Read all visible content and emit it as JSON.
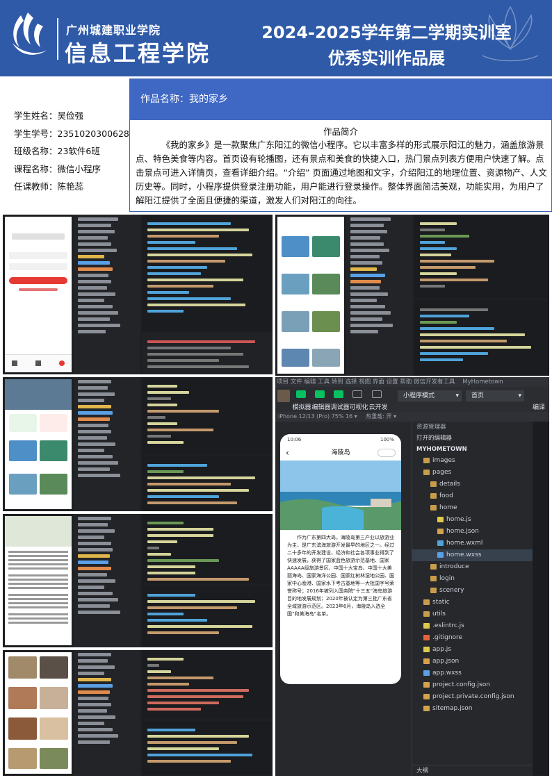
{
  "header": {
    "school": "广州城建职业学院",
    "college": "信息工程学院",
    "exhibit_title": "2024-2025学年第二学期实训室",
    "exhibit_subtitle": "优秀实训作品展"
  },
  "student_info": [
    "学生姓名：吴俭强",
    "学生学号：2351020300628",
    "班级名称：23软件6班",
    "课程名称：微信小程序",
    "任课教师：陈艳蕊"
  ],
  "work": {
    "name_line": "作品名称：我的家乡",
    "intro_title": "作品简介",
    "intro_body": "《我的家乡》是一款聚焦广东阳江的微信小程序。它以丰富多样的形式展示阳江的魅力，涵盖旅游景点、特色美食等内容。首页设有轮播图，还有景点和美食的快捷入口，热门景点列表方便用户快速了解。点击景点可进入详情页，查看详细介绍。“介绍” 页面通过地图和文字，介绍阳江的地理位置、资源物产、人文历史等。同时，小程序提供登录注册功能，用户能进行登录操作。整体界面简洁美观，功能实用，为用户了解阳江提供了全面且便捷的渠道，激发人们对阳江的向往。"
  },
  "ide": {
    "menu": "项目 文件 编辑 工具 转到 选择 视图 界面 设置 帮助 微信开发者工具",
    "project_name": "MyHometown",
    "toolbar": [
      "模拟器",
      "编辑器",
      "调试器",
      "可视化",
      "云开发"
    ],
    "compile_mode": "小程序模式",
    "page_select": "首页",
    "translate": "编译",
    "device": "iPhone 12/13 (Pro) 75% 16 ▾",
    "hot_reload": "热重载: 开 ▾",
    "explorer_title": "资源管理器",
    "open_editors": "打开的编辑器",
    "root_folder": "MYHOMETOWN",
    "outline": "大纲",
    "file_tree": [
      {
        "name": "images",
        "kind": "folder",
        "depth": 1
      },
      {
        "name": "pages",
        "kind": "folder",
        "depth": 1
      },
      {
        "name": "details",
        "kind": "folder",
        "depth": 2
      },
      {
        "name": "food",
        "kind": "folder",
        "depth": 2
      },
      {
        "name": "home",
        "kind": "folder",
        "depth": 2
      },
      {
        "name": "home.js",
        "kind": "js",
        "depth": 3
      },
      {
        "name": "home.json",
        "kind": "json",
        "depth": 3
      },
      {
        "name": "home.wxml",
        "kind": "wxml",
        "depth": 3
      },
      {
        "name": "home.wxss",
        "kind": "wxss",
        "depth": 3
      },
      {
        "name": "introduce",
        "kind": "folder",
        "depth": 2
      },
      {
        "name": "login",
        "kind": "folder",
        "depth": 2
      },
      {
        "name": "scenery",
        "kind": "folder",
        "depth": 2
      },
      {
        "name": "static",
        "kind": "folder",
        "depth": 1
      },
      {
        "name": "utils",
        "kind": "folder",
        "depth": 1
      },
      {
        "name": ".eslintrc.js",
        "kind": "js",
        "depth": 1
      },
      {
        "name": ".gitignore",
        "kind": "git",
        "depth": 1
      },
      {
        "name": "app.js",
        "kind": "js",
        "depth": 1
      },
      {
        "name": "app.json",
        "kind": "json",
        "depth": 1
      },
      {
        "name": "app.wxss",
        "kind": "wxss",
        "depth": 1
      },
      {
        "name": "project.config.json",
        "kind": "json",
        "depth": 1
      },
      {
        "name": "project.private.config.json",
        "kind": "json",
        "depth": 1
      },
      {
        "name": "sitemap.json",
        "kind": "json",
        "depth": 1
      }
    ],
    "phone": {
      "time": "10:06",
      "battery": "100%",
      "page_title": "海陵岛",
      "text": "作为广东第四大岛，海陵岛第三产业以旅游业为主，是广东滨海旅游开发最早的地区之一。经过二十多年的开发建设，经济和社会各项事业得到了快速发展，获得了国家蓝色旅游示范基地、国家AAAAA级旅游景区、中国十大宝岛、中国十大美丽海岛、国家海洋公园、国家红树林湿地公园、国家中心渔港、国家水下考古基地等一大批国字号荣誉称号；2016年被列入国务院“十三五”海岛旅游目的地发展规划；2020年被认定为第三批广东省全域旅游示范区。2023年6月，海陵岛入选全国“和美海岛”名单。"
    }
  },
  "colors": {
    "banner": "#2f5aa8",
    "work_head": "#3f68c4",
    "ide_bg": "#1e1f22",
    "accent_green": "#07c160",
    "login_red": "#e53935"
  }
}
